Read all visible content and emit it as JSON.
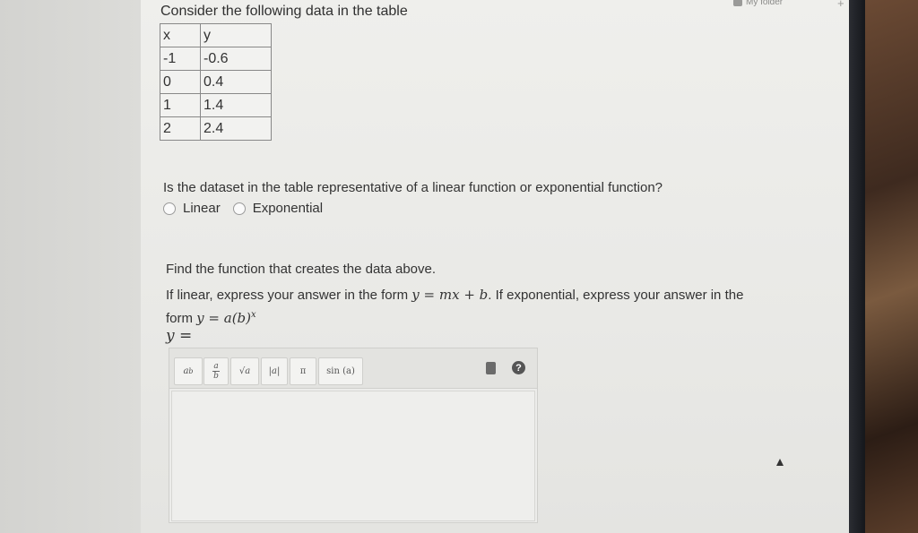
{
  "header": {
    "folder_label": "My folder",
    "plus_icon": "plus-icon"
  },
  "intro": "Consider the following data in the table",
  "table": {
    "headers": [
      "x",
      "y"
    ],
    "rows": [
      [
        "-1",
        "-0.6"
      ],
      [
        "0",
        "0.4"
      ],
      [
        "1",
        "1.4"
      ],
      [
        "2",
        "2.4"
      ]
    ]
  },
  "question": {
    "text": "Is the dataset in the table representative of a linear function or exponential function?",
    "options": [
      "Linear",
      "Exponential"
    ]
  },
  "find": {
    "text": "Find the function that creates the data above.",
    "instr_prefix": "If linear, express your answer in the form ",
    "linear_form": "y = mx + b",
    "instr_middle": ". If exponential, express your answer in the form ",
    "exp_form": "y = a(b)",
    "exp_sup": "x",
    "y_equals": "y ="
  },
  "toolbar": {
    "exponent_label": "a",
    "exponent_sup": "b",
    "fraction_num": "a",
    "fraction_den": "b",
    "sqrt_label": "√a",
    "abs_label": "|a|",
    "pi_label": "π",
    "sin_label": "sin (a)",
    "help_label": "?"
  }
}
